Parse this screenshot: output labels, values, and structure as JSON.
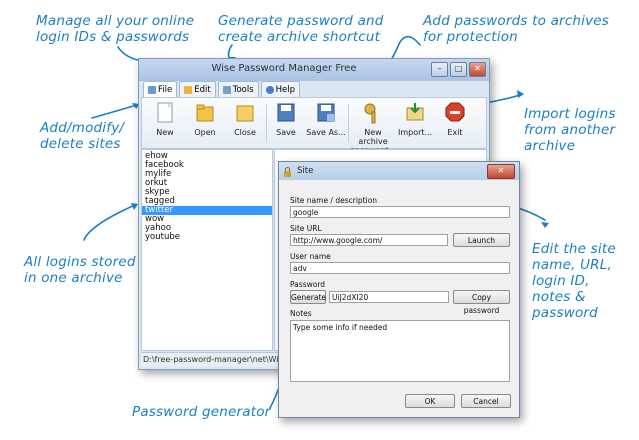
{
  "annotations": {
    "manage": [
      "Manage all your online",
      "login IDs & passwords"
    ],
    "generate": [
      "Generate password and",
      "create archive shortcut"
    ],
    "add_archives": [
      "Add passwords to archives",
      "for protection"
    ],
    "add_modify": [
      "Add/modify/",
      "delete sites"
    ],
    "import": [
      "Import logins",
      "from another",
      "archive"
    ],
    "all_logins": [
      "All logins stored",
      "in one archive"
    ],
    "edit_site": [
      "Edit the site",
      "name, URL,",
      "login ID,",
      "notes &",
      "password"
    ],
    "password_generator": "Password generator"
  },
  "main_window": {
    "title": "Wise Password Manager Free",
    "controls": {
      "minimize": "–",
      "maximize": "□",
      "close": "✕"
    },
    "tabs": [
      "File",
      "Edit",
      "Tools",
      "Help"
    ],
    "toolbar": {
      "new": "New",
      "open": "Open",
      "close": "Close",
      "save": "Save",
      "save_as": "Save As...",
      "new_archive": [
        "New archive",
        "password..."
      ],
      "import": "Import...",
      "exit": "Exit"
    },
    "sites": [
      "ehow",
      "facebook",
      "mylife",
      "orkut",
      "skype",
      "tagged",
      "twitter",
      "wow",
      "yahoo",
      "youtube"
    ],
    "selected_site": "twitter",
    "status": "D:\\free-password-manager\\net\\Wise"
  },
  "site_dialog": {
    "title": "Site",
    "close": "✕",
    "name_label": "Site name / description",
    "name_value": "google",
    "url_label": "Site URL",
    "url_value": "http://www.google.com/",
    "launch": "Launch",
    "user_label": "User name",
    "user_value": "adv",
    "password_label": "Password",
    "generate": "Generate",
    "password_value": "UiJ2dXI20",
    "copy_password": "Copy password",
    "notes_label": "Notes",
    "notes_value": "Type some info if needed",
    "ok": "OK",
    "cancel": "Cancel"
  },
  "colors": {
    "annotation": "#1a7fc4",
    "selection": "#3399ff"
  }
}
